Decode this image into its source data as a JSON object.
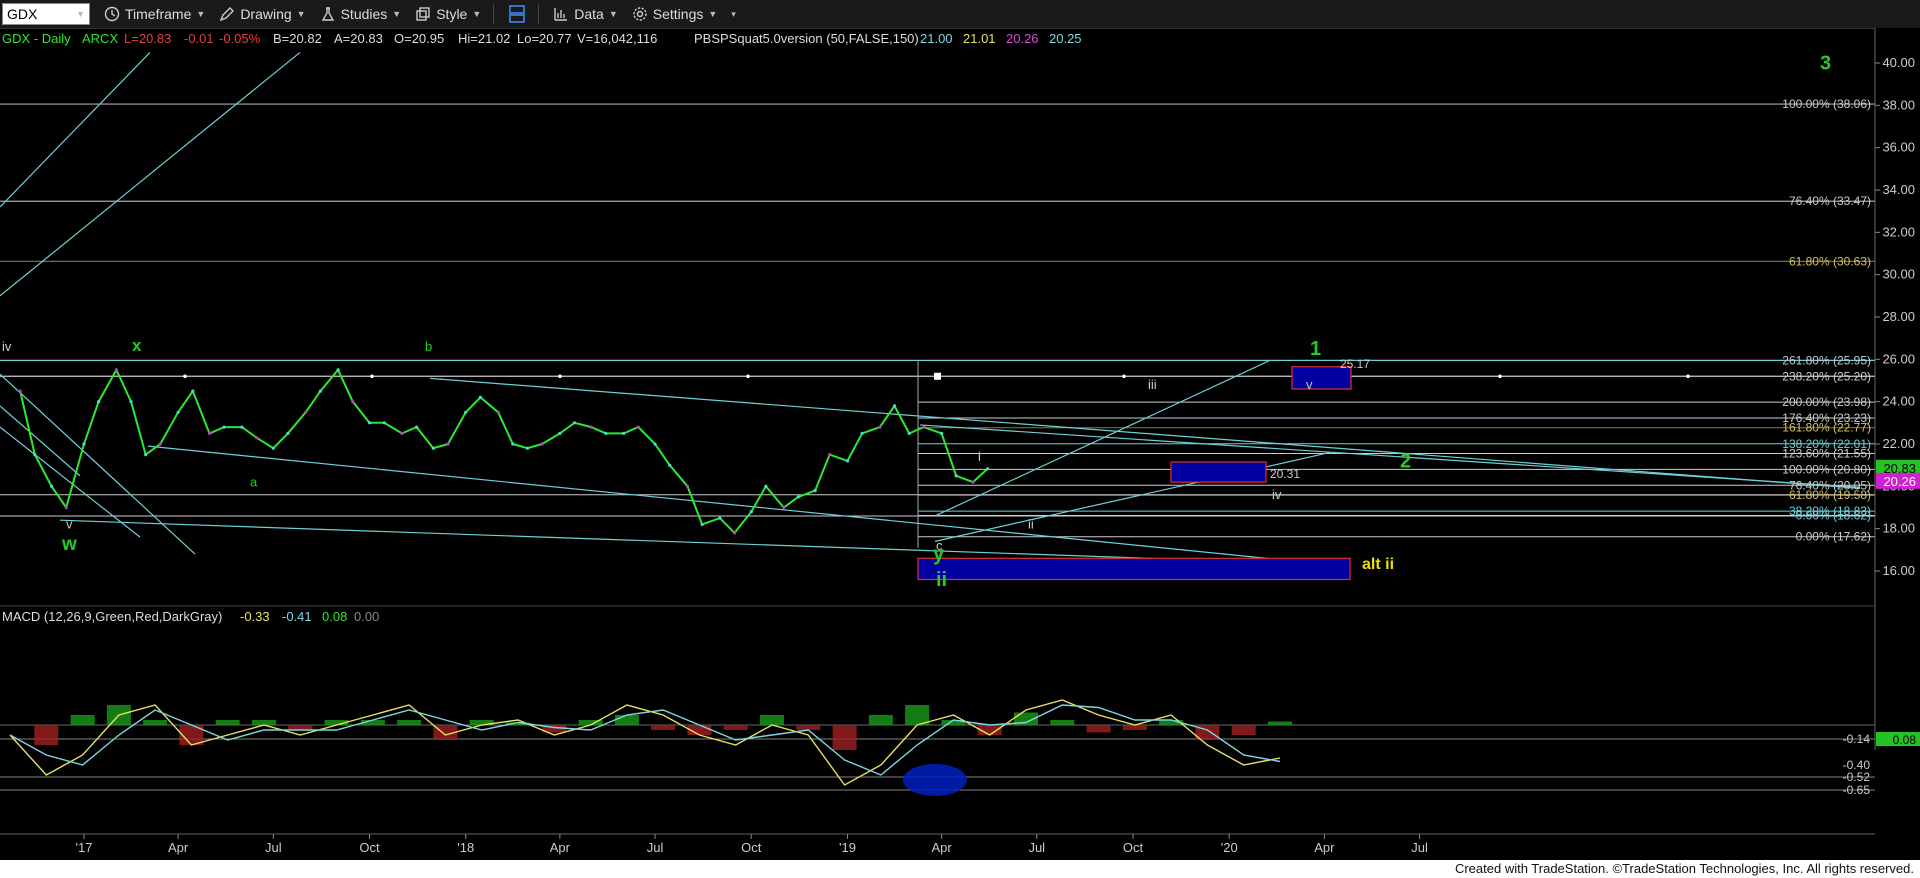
{
  "toolbar": {
    "symbol": "GDX",
    "timeframe_label": "Timeframe",
    "drawing_label": "Drawing",
    "studies_label": "Studies",
    "style_label": "Style",
    "data_label": "Data",
    "settings_label": "Settings"
  },
  "header": {
    "symbol_tf": "GDX - Daily",
    "exchange": "ARCX",
    "last": "L=20.83",
    "change": "-0.01",
    "pct": "-0.05%",
    "bid": "B=20.82",
    "ask": "A=20.83",
    "open": "O=20.95",
    "high": "Hi=21.02",
    "low": "Lo=20.77",
    "volume": "V=16,042,116",
    "study": "PBSPSquat5.0version (50,FALSE,150)",
    "study_vals": [
      "21.00",
      "21.01",
      "20.26",
      "20.25"
    ]
  },
  "macd": {
    "title": "MACD (12,26,9,Green,Red,DarkGray)",
    "vals": [
      "-0.33",
      "-0.41",
      "0.08",
      "0.00"
    ],
    "axis": [
      "-0.14",
      "0.08",
      "-0.40",
      "-0.52",
      "-0.65"
    ]
  },
  "price_axis": {
    "ticks": [
      "40.00",
      "38.00",
      "36.00",
      "34.00",
      "32.00",
      "30.00",
      "28.00",
      "26.00",
      "24.00",
      "22.00",
      "20.00",
      "18.00",
      "16.00"
    ],
    "last_badge": "20.83",
    "study_badge": "20.26"
  },
  "time_axis": [
    "'17",
    "Apr",
    "Jul",
    "Oct",
    "'18",
    "Apr",
    "Jul",
    "Oct",
    "'19",
    "Apr",
    "Jul",
    "Oct",
    "'20",
    "Apr",
    "Jul"
  ],
  "fib_upper": [
    "100.00% (38.06)",
    "76.40% (33.47)",
    "61.80% (30.63)",
    "261.80% (25.95)",
    "238.20% (25.20)",
    "200.00% (23.98)",
    "176.40% (23.23)",
    "161.80% (22.77)",
    "138.20% (22.01)",
    "123.60% (21.55)",
    "100.00% (20.80)",
    "76.40% (20.05)",
    "61.80% (19.58)",
    "38.20% (18.83)",
    "0.00% (18.62)",
    "0.00% (17.62)"
  ],
  "wave_labels": [
    "iv",
    "x",
    "b",
    "w",
    "v",
    "a",
    "y",
    "ii",
    "c",
    "i",
    "ii",
    "iii",
    "iv",
    "v",
    "1",
    "2",
    "3",
    "alt ii",
    "25.17",
    "20.31"
  ],
  "colors": {
    "bg": "#000000",
    "price": "#2ee82e",
    "accent_box": "#0000a0",
    "wave_green": "#22cc22",
    "wave_yellow": "#f0e000",
    "grid_white": "#cccccc",
    "trend_cyan": "#6fd0d8"
  },
  "chart_data": {
    "type": "line",
    "title": "GDX - Daily",
    "xlabel": "",
    "ylabel": "",
    "ylim": [
      15,
      41
    ],
    "x_range": [
      "2016-11",
      "2020-07"
    ],
    "series": [
      {
        "values_x": [
          "2016-11-01",
          "2016-11-15",
          "2016-12-01",
          "2016-12-15",
          "2017-01-01",
          "2017-01-15",
          "2017-02-01",
          "2017-02-15",
          "2017-03-01",
          "2017-03-15",
          "2017-04-01",
          "2017-04-15",
          "2017-05-01",
          "2017-05-15",
          "2017-06-01",
          "2017-06-15",
          "2017-07-01",
          "2017-07-15",
          "2017-08-01",
          "2017-08-15",
          "2017-09-01",
          "2017-09-15",
          "2017-10-01",
          "2017-10-15",
          "2017-11-01",
          "2017-11-15",
          "2017-12-01",
          "2017-12-15",
          "2018-01-01",
          "2018-01-15",
          "2018-02-01",
          "2018-02-15",
          "2018-03-01",
          "2018-03-15",
          "2018-04-01",
          "2018-04-15",
          "2018-05-01",
          "2018-05-15",
          "2018-06-01",
          "2018-06-15",
          "2018-07-01",
          "2018-07-15",
          "2018-08-01",
          "2018-08-15",
          "2018-09-01",
          "2018-09-15",
          "2018-10-01",
          "2018-10-15",
          "2018-11-01",
          "2018-11-15",
          "2018-12-01",
          "2018-12-15",
          "2019-01-01",
          "2019-01-15",
          "2019-02-01",
          "2019-02-15",
          "2019-03-01",
          "2019-03-15",
          "2019-04-01",
          "2019-04-15",
          "2019-05-01",
          "2019-05-15"
        ],
        "values": [
          24.5,
          21.5,
          20.0,
          19.0,
          22.0,
          24.0,
          25.5,
          24.0,
          21.5,
          22.0,
          23.5,
          24.5,
          22.5,
          22.8,
          22.8,
          22.3,
          21.8,
          22.5,
          23.5,
          24.5,
          25.5,
          24.0,
          23.0,
          23.0,
          22.5,
          22.8,
          21.8,
          22.0,
          23.5,
          24.2,
          23.5,
          22.0,
          21.8,
          22.0,
          22.5,
          23.0,
          22.8,
          22.5,
          22.5,
          22.8,
          22.0,
          21.0,
          20.0,
          18.2,
          18.5,
          17.8,
          18.8,
          20.0,
          19.0,
          19.5,
          19.8,
          21.5,
          21.2,
          22.5,
          22.8,
          23.8,
          22.5,
          22.8,
          22.5,
          20.5,
          20.2,
          20.83
        ]
      }
    ]
  },
  "footer": "Created with TradeStation. ©TradeStation Technologies, Inc. All rights reserved."
}
